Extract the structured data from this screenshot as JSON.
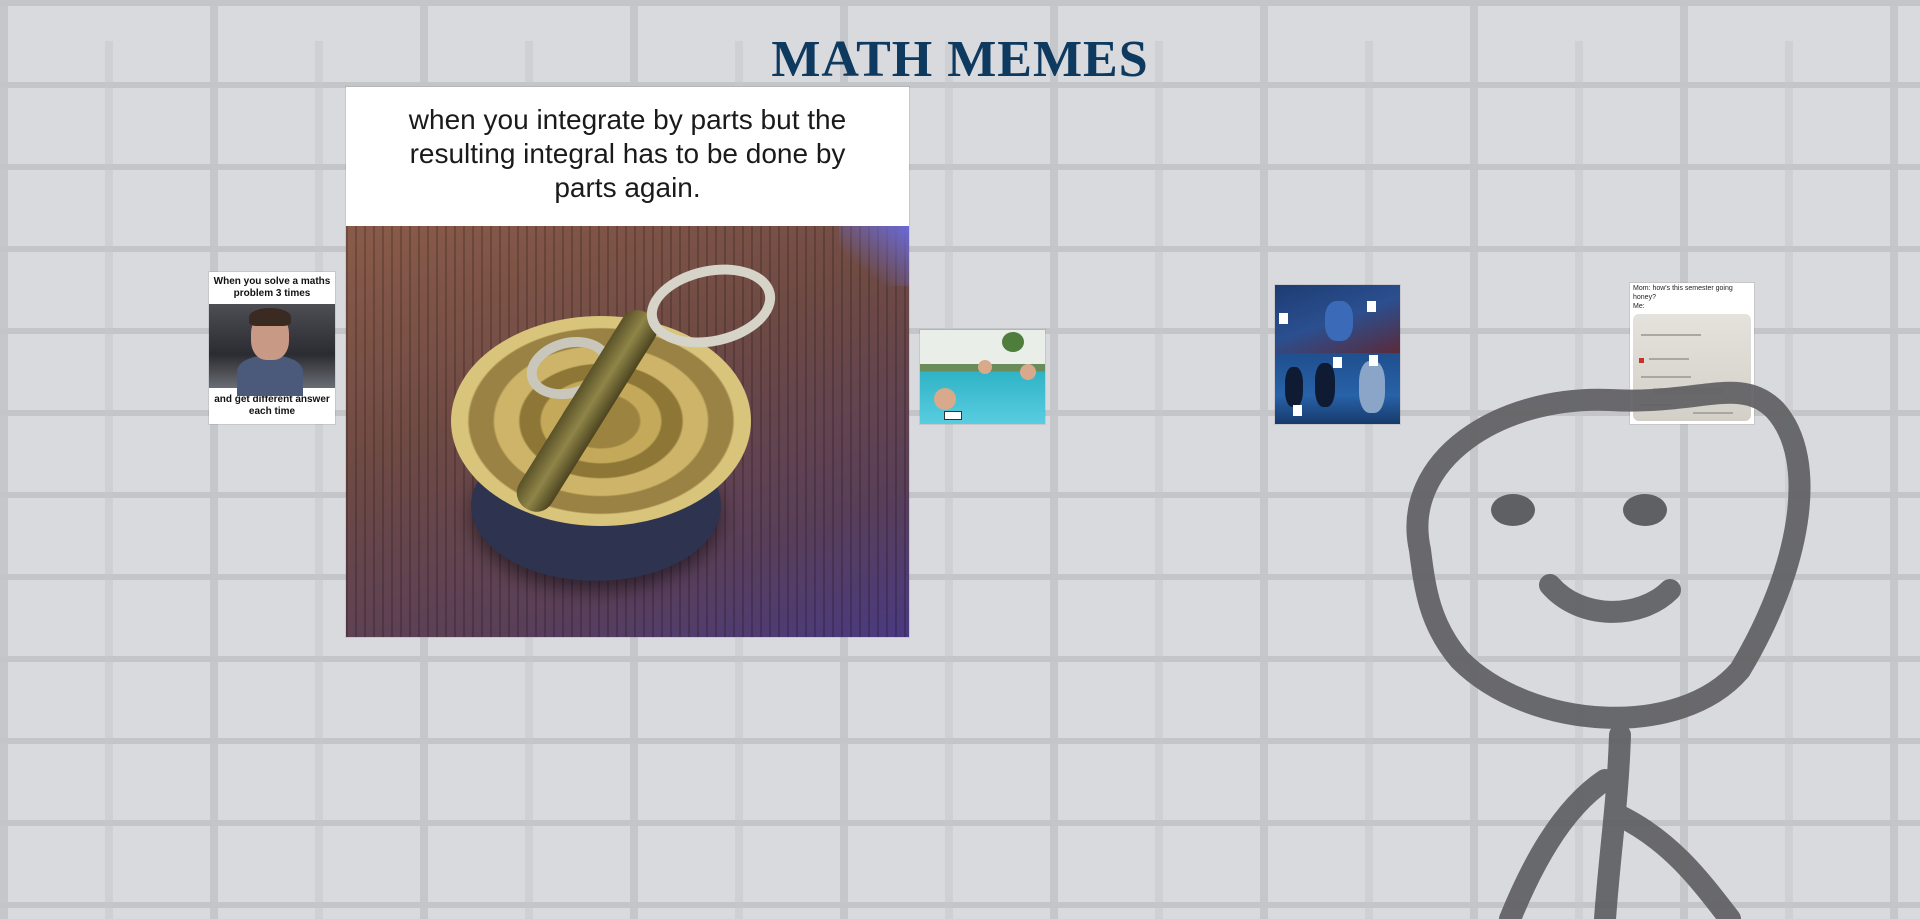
{
  "page": {
    "title": "MATH MEMES"
  },
  "memes": [
    {
      "id": "spiderman",
      "caption_top": "When you solve a maths problem 3 times",
      "caption_bottom": "and get different answer each time"
    },
    {
      "id": "can",
      "caption_top": "when you integrate by parts but the resulting integral has to be done by parts again."
    },
    {
      "id": "pool"
    },
    {
      "id": "hercules"
    },
    {
      "id": "grades",
      "caption_top": "Mom: how's this semester going honey?",
      "caption_me": "Me:"
    }
  ],
  "colors": {
    "title": "#0f3a60",
    "background": "#d9dade",
    "stick_figure": "#5f6063"
  }
}
